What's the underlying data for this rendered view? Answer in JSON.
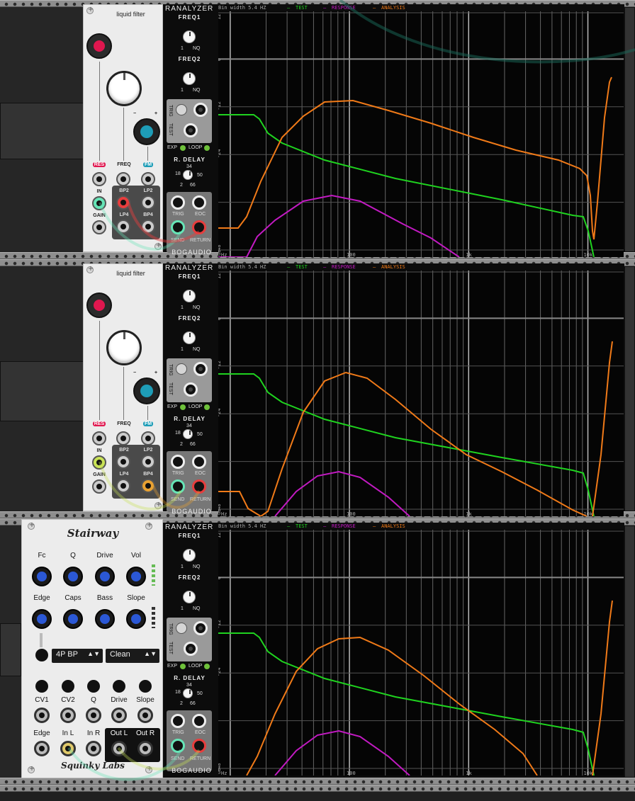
{
  "liquid_filter": {
    "title": "liquid filter",
    "labels": {
      "res": "RES",
      "freq": "FREQ",
      "fm": "FM",
      "in": "IN",
      "gain": "GAIN",
      "bp2": "BP2",
      "lp2": "LP2",
      "lp4": "LP4",
      "bp4": "BP4"
    },
    "fm_minus": "−",
    "fm_plus": "+"
  },
  "analyzer": {
    "title": "RANALYZER",
    "brand": "BOGAUDIO",
    "bin_width": "Bin width 5.4 HZ",
    "legend": {
      "test": "TEST",
      "response": "RESPONSE",
      "analysis": "ANALYSIS"
    },
    "freq1": "FREQ1",
    "freq2": "FREQ2",
    "knob_min": "1",
    "knob_max": "NQ",
    "trig": "TRIG",
    "test": "TEST",
    "exp": "EXP",
    "loop": "LOOP",
    "rdelay": "R. DELAY",
    "rdelay_ticks": {
      "t18": "18",
      "t34": "34",
      "t50": "50",
      "t2": "2",
      "t66": "66"
    },
    "jack_labels": {
      "trig": "TRIG",
      "eoc": "EOC",
      "send": "SEND",
      "return": "RETURN"
    },
    "y_ticks": [
      "12",
      "0",
      "-12",
      "-24",
      "-48",
      "dB"
    ],
    "x_ticks": [
      "Hz",
      "100",
      "1k",
      "10k"
    ],
    "colors": {
      "test": "#1fd31f",
      "response": "#c21ac2",
      "analysis": "#f07a18"
    }
  },
  "stairway": {
    "title": "Stairway",
    "brand": "Squinky Labs",
    "row1": [
      "Fc",
      "Q",
      "Drive",
      "Vol"
    ],
    "row2": [
      "Edge",
      "Caps",
      "Bass",
      "Slope"
    ],
    "mode_select": "4P BP",
    "voicing_select": "Clean",
    "cv_row": [
      "CV1",
      "CV2",
      "Q",
      "Drive",
      "Slope"
    ],
    "io_row": [
      "Edge",
      "In L",
      "In R",
      "Out L",
      "Out R"
    ]
  }
}
